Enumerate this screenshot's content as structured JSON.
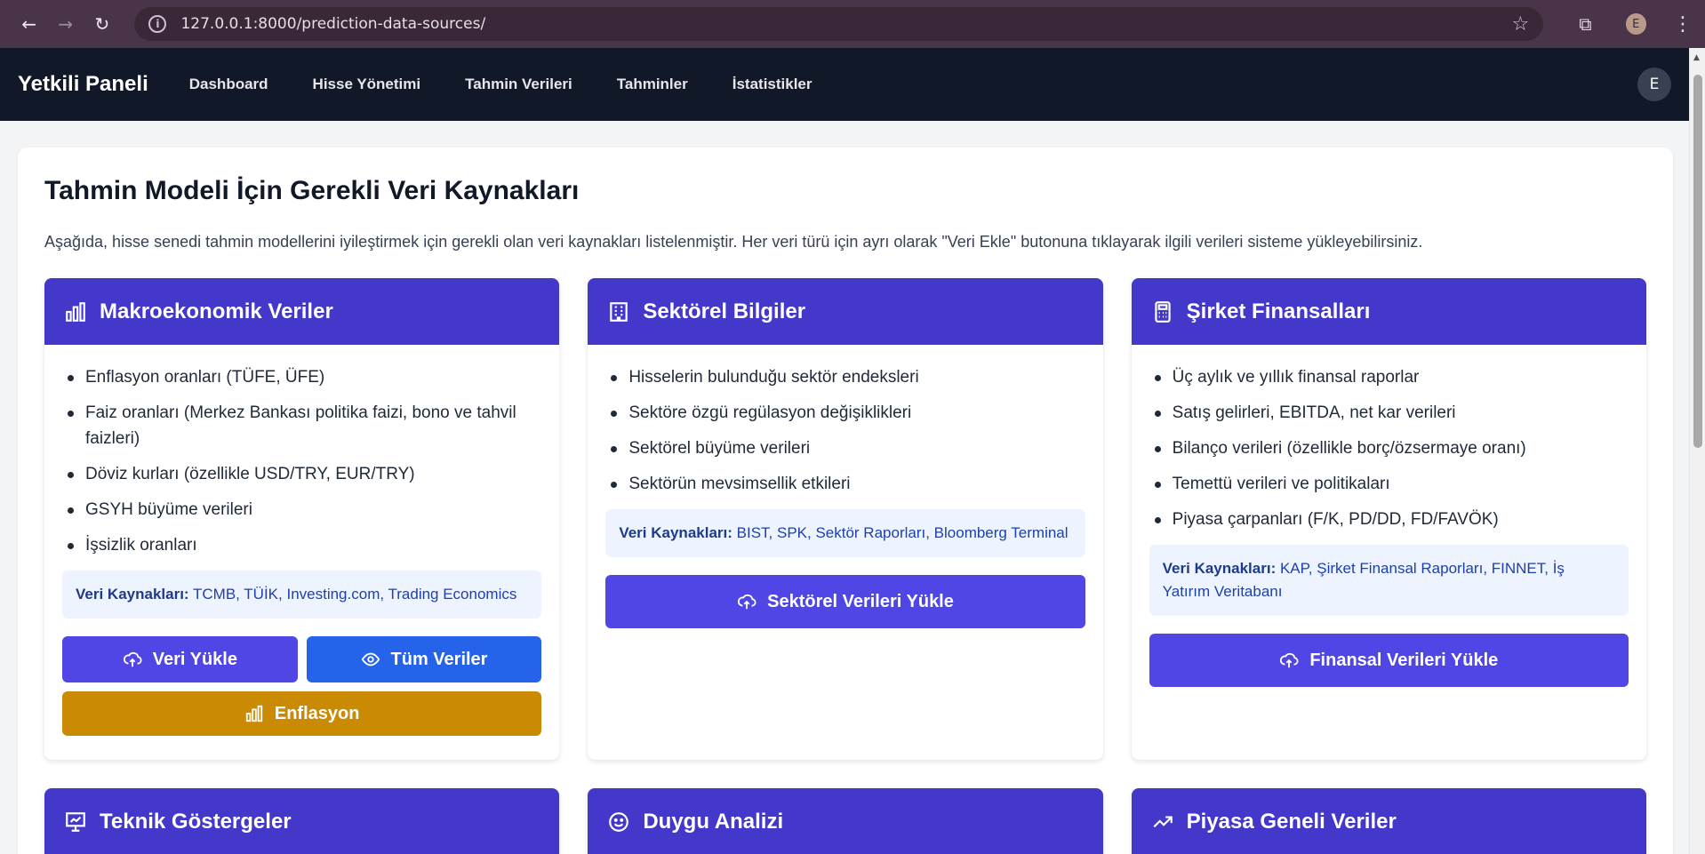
{
  "browser": {
    "url": "127.0.0.1:8000/prediction-data-sources/",
    "profile_initial": "E"
  },
  "nav": {
    "brand": "Yetkili Paneli",
    "links": [
      "Dashboard",
      "Hisse Yönetimi",
      "Tahmin Verileri",
      "Tahminler",
      "İstatistikler"
    ],
    "avatar_initial": "E"
  },
  "page": {
    "title": "Tahmin Modeli İçin Gerekli Veri Kaynakları",
    "intro": "Aşağıda, hisse senedi tahmin modellerini iyileştirmek için gerekli olan veri kaynakları listelenmiştir. Her veri türü için ayrı olarak \"Veri Ekle\" butonuna tıklayarak ilgili verileri sisteme yükleyebilirsiniz."
  },
  "cards": [
    {
      "title": "Makroekonomik Veriler",
      "icon": "bar-chart-icon",
      "items": [
        "Enflasyon oranları (TÜFE, ÜFE)",
        "Faiz oranları (Merkez Bankası politika faizi, bono ve tahvil faizleri)",
        "Döviz kurları (özellikle USD/TRY, EUR/TRY)",
        "GSYH büyüme verileri",
        "İşsizlik oranları"
      ],
      "sources_label": "Veri Kaynakları:",
      "sources": "TCMB, TÜİK, Investing.com, Trading Economics",
      "buttons": {
        "upload": "Veri Yükle",
        "view_all": "Tüm Veriler",
        "inflation": "Enflasyon"
      }
    },
    {
      "title": "Sektörel Bilgiler",
      "icon": "building-icon",
      "items": [
        "Hisselerin bulunduğu sektör endeksleri",
        "Sektöre özgü regülasyon değişiklikleri",
        "Sektörel büyüme verileri",
        "Sektörün mevsimsellik etkileri"
      ],
      "sources_label": "Veri Kaynakları:",
      "sources": "BIST, SPK, Sektör Raporları, Bloomberg Terminal",
      "button": "Sektörel Verileri Yükle"
    },
    {
      "title": "Şirket Finansalları",
      "icon": "calculator-icon",
      "items": [
        "Üç aylık ve yıllık finansal raporlar",
        "Satış gelirleri, EBITDA, net kar verileri",
        "Bilanço verileri (özellikle borç/özsermaye oranı)",
        "Temettü verileri ve politikaları",
        "Piyasa çarpanları (F/K, PD/DD, FD/FAVÖK)"
      ],
      "sources_label": "Veri Kaynakları:",
      "sources": "KAP, Şirket Finansal Raporları, FINNET, İş Yatırım Veritabanı",
      "button": "Finansal Verileri Yükle"
    }
  ],
  "cards_row2": [
    {
      "title": "Teknik Göstergeler",
      "icon": "presentation-chart-icon"
    },
    {
      "title": "Duygu Analizi",
      "icon": "smiley-icon"
    },
    {
      "title": "Piyasa Geneli Veriler",
      "icon": "trending-up-icon"
    }
  ]
}
